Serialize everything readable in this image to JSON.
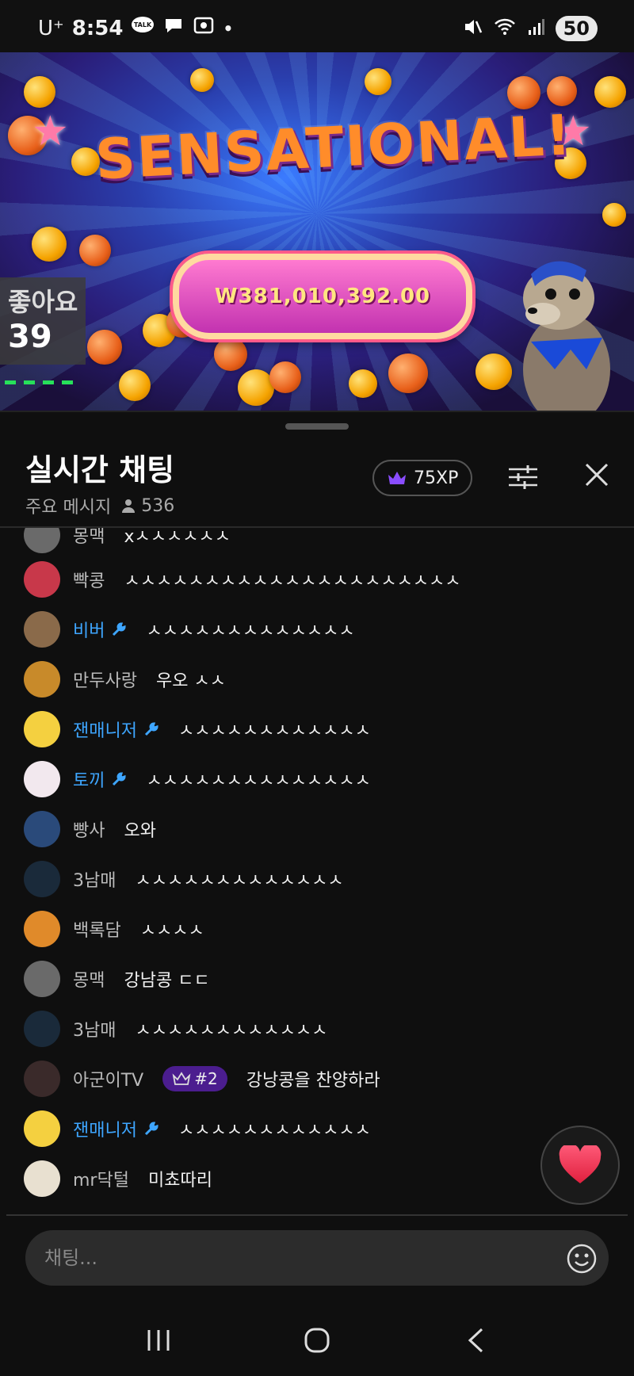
{
  "status_bar": {
    "carrier": "U⁺",
    "time": "8:54",
    "talk_label": "TALK",
    "battery": "50"
  },
  "video": {
    "banner": "SENSATIONAL!",
    "win_amount": "W381,010,392.00",
    "likes_label": "좋아요",
    "likes_count": "39"
  },
  "chat": {
    "title": "실시간 채팅",
    "mode": "주요 메시지",
    "viewers": "536",
    "xp": "75XP",
    "messages": [
      {
        "user": "몽맥",
        "text": "xㅅㅅㅅㅅㅅㅅ",
        "mod": false,
        "avatar": "#6a6a6a"
      },
      {
        "user": "빡콩",
        "text": "ㅅㅅㅅㅅㅅㅅㅅㅅㅅㅅㅅㅅㅅㅅㅅㅅㅅㅅㅅㅅㅅ",
        "mod": false,
        "avatar": "#c8384a"
      },
      {
        "user": "비버",
        "text": "ㅅㅅㅅㅅㅅㅅㅅㅅㅅㅅㅅㅅㅅ",
        "mod": true,
        "avatar": "#8a6a4a"
      },
      {
        "user": "만두사랑",
        "text": "우오 ㅅㅅ",
        "mod": false,
        "avatar": "#c88a2a"
      },
      {
        "user": "잰매니저",
        "text": "ㅅㅅㅅㅅㅅㅅㅅㅅㅅㅅㅅㅅ",
        "mod": true,
        "avatar": "#f4d040"
      },
      {
        "user": "토끼",
        "text": "ㅅㅅㅅㅅㅅㅅㅅㅅㅅㅅㅅㅅㅅㅅ",
        "mod": true,
        "avatar": "#f2e8ee"
      },
      {
        "user": "빵사",
        "text": "오와",
        "mod": false,
        "avatar": "#2a4a7a"
      },
      {
        "user": "3남매",
        "text": "ㅅㅅㅅㅅㅅㅅㅅㅅㅅㅅㅅㅅㅅ",
        "mod": false,
        "avatar": "#1a2a3a"
      },
      {
        "user": "백록담",
        "text": "ㅅㅅㅅㅅ",
        "mod": false,
        "avatar": "#e08a2a"
      },
      {
        "user": "몽맥",
        "text": "강남콩 ㄷㄷ",
        "mod": false,
        "avatar": "#6a6a6a"
      },
      {
        "user": "3남매",
        "text": "ㅅㅅㅅㅅㅅㅅㅅㅅㅅㅅㅅㅅ",
        "mod": false,
        "avatar": "#1a2a3a"
      },
      {
        "user": "아군이TV",
        "text": "강낭콩을 찬양하라",
        "mod": false,
        "badge": "#2",
        "avatar": "#3a2a2a"
      },
      {
        "user": "잰매니저",
        "text": "ㅅㅅㅅㅅㅅㅅㅅㅅㅅㅅㅅㅅ",
        "mod": true,
        "avatar": "#f4d040"
      },
      {
        "user": "mr닥털",
        "text": "미쵸따리",
        "mod": false,
        "avatar": "#e8e0d0"
      }
    ]
  },
  "input": {
    "placeholder": "채팅..."
  },
  "colors": {
    "accent_mod": "#3ea6ff",
    "badge_bg": "#4b1d8f",
    "heart": "#ff3b5c",
    "xp_crown": "#8a4dff"
  }
}
